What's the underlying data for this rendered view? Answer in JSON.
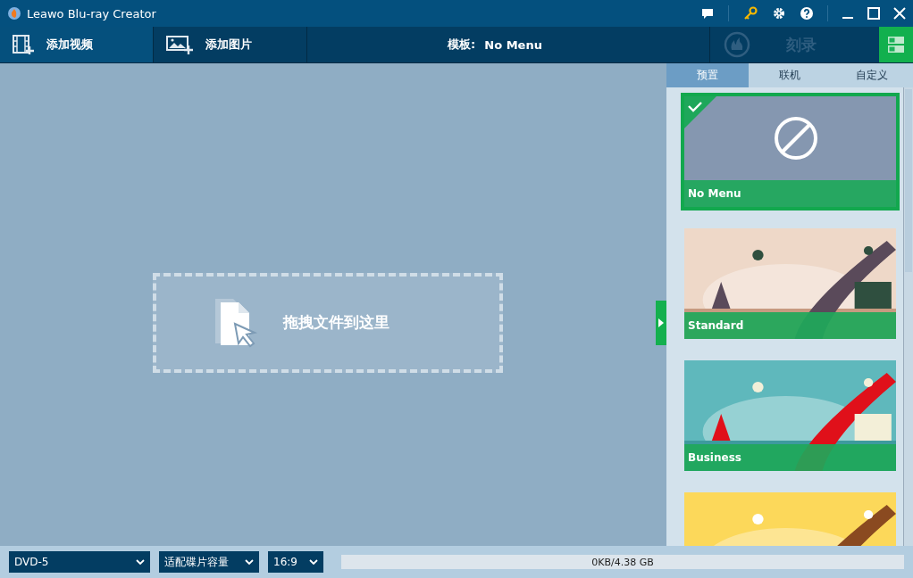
{
  "window": {
    "title": "Leawo Blu-ray Creator"
  },
  "toolbar": {
    "buttons": [
      {
        "label": "添加视频",
        "kind": "video",
        "selected": true
      },
      {
        "label": "添加图片",
        "selected": false
      }
    ],
    "template_label": "模板:",
    "template_value": "No Menu",
    "burn_label": "刻录",
    "burn_disabled": true
  },
  "drop_zone": {
    "text": "拖拽文件到这里"
  },
  "sidebar": {
    "tabs": [
      {
        "label": "预置",
        "selected": true
      },
      {
        "label": "联机",
        "selected": false
      },
      {
        "label": "自定义",
        "selected": false
      }
    ],
    "templates": [
      {
        "name": "No Menu",
        "kind": "none",
        "selected": true
      },
      {
        "name": "Standard",
        "kind": "picture",
        "selected": false
      },
      {
        "name": "Business",
        "kind": "picture",
        "selected": false
      },
      {
        "kind": "picture",
        "selected": false
      }
    ]
  },
  "status_bar": {
    "disc": "DVD-5",
    "quality": "适配碟片容量",
    "ratio": "16:9",
    "capacity": "0KB/4.38 GB"
  }
}
